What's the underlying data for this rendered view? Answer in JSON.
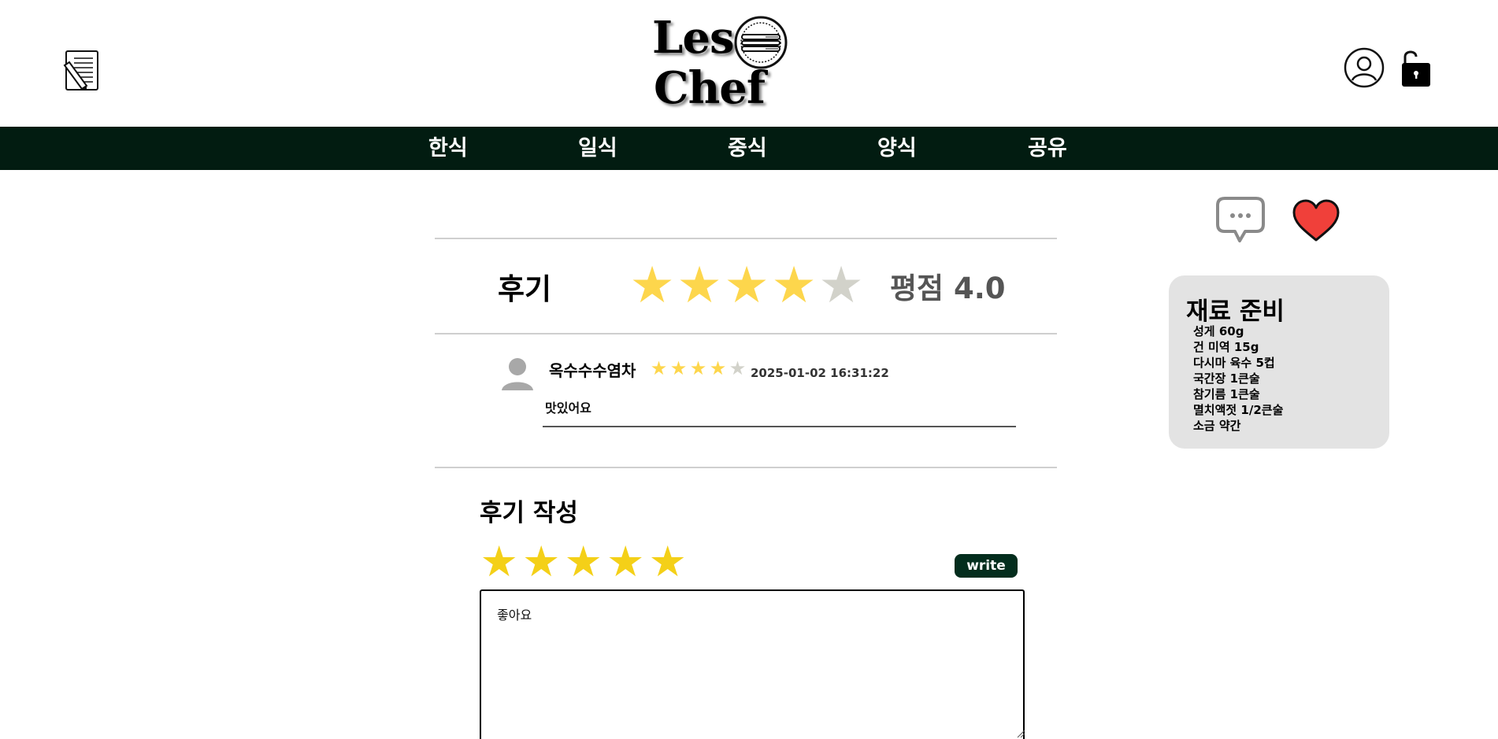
{
  "header": {
    "logo_line1": "Les",
    "logo_line2": "Chef",
    "left_icon": "notepad-pencil-icon",
    "right_icons": [
      "user-circle-icon",
      "unlocked-lock-icon"
    ]
  },
  "nav": {
    "items": [
      {
        "label": "한식"
      },
      {
        "label": "일식"
      },
      {
        "label": "중식"
      },
      {
        "label": "양식"
      },
      {
        "label": "공유"
      }
    ]
  },
  "actions": {
    "comment_icon": "speech-bubble-icon",
    "like_icon": "heart-icon"
  },
  "ingredients": {
    "title": "재료 준비",
    "items": [
      "성게 60g",
      "건 미역 15g",
      "다시마 육수 5컵",
      "국간장 1큰술",
      "참기름 1큰술",
      "멸치액젓 1/2큰술",
      "소금 약간"
    ]
  },
  "review_summary": {
    "title": "후기",
    "rating_label": "평점 4.0",
    "rating": 4,
    "max_rating": 5
  },
  "reviews": [
    {
      "author": "옥수수수염차",
      "rating": 4,
      "date": "2025-01-02 16:31:22",
      "text": "맛있어요"
    }
  ],
  "write_review": {
    "title": "후기 작성",
    "rating": 5,
    "button_label": "write",
    "text_value": "좋아요"
  },
  "colors": {
    "nav_bg": "#021c11",
    "star_filled": "#fdd64c",
    "star_empty": "#d2d2ca",
    "input_star": "#f4d018",
    "button_bg": "#032d1d",
    "heart": "#f0403a",
    "card_bg": "#e3e3e3"
  }
}
